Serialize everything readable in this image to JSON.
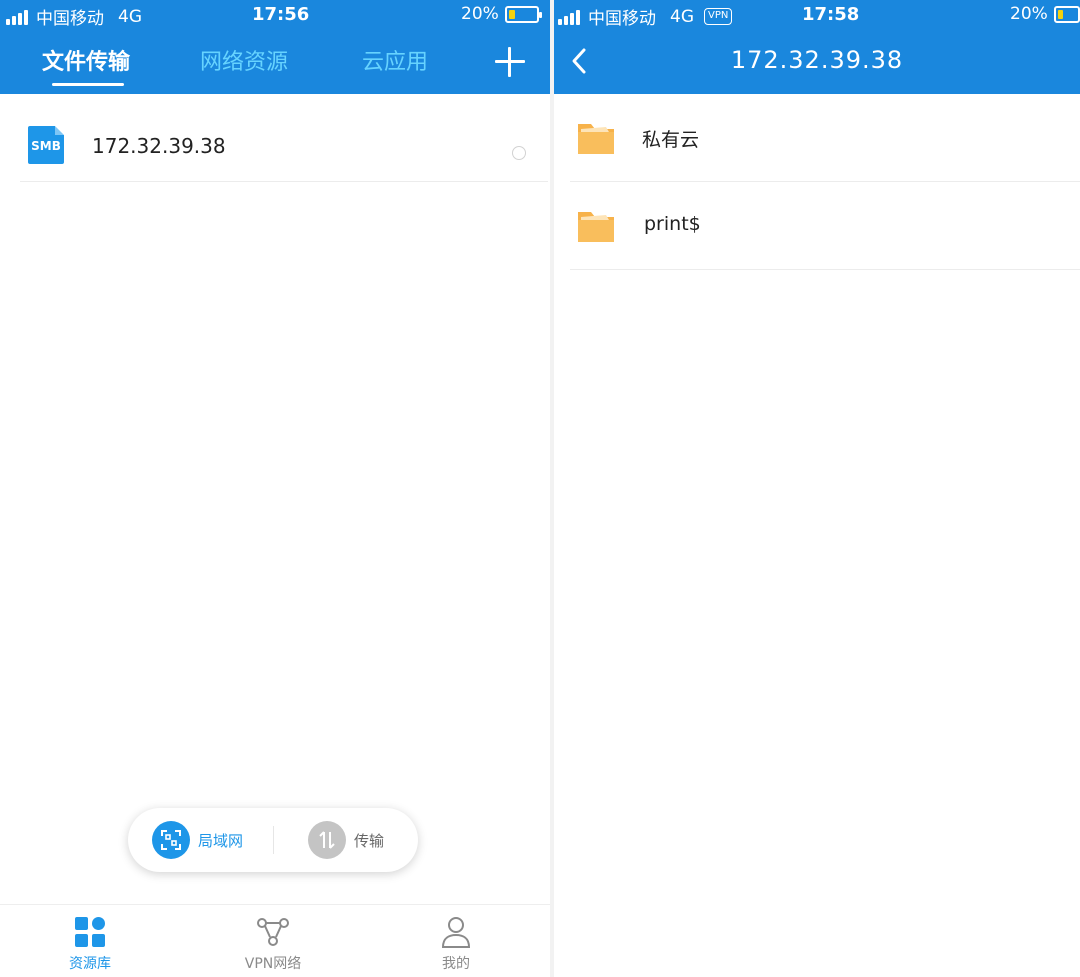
{
  "left": {
    "status": {
      "carrier": "中国移动",
      "network": "4G",
      "time": "17:56",
      "battery": "20%"
    },
    "tabs": [
      {
        "label": "文件传输",
        "active": true
      },
      {
        "label": "网络资源",
        "active": false
      },
      {
        "label": "云应用",
        "active": false
      }
    ],
    "rows": [
      {
        "icon_text": "SMB",
        "label": "172.32.39.38"
      }
    ],
    "pill": {
      "lan_label": "局域网",
      "transfer_label": "传输"
    },
    "bottom_nav": [
      {
        "label": "资源库",
        "active": true,
        "icon": "grid-icon"
      },
      {
        "label": "VPN网络",
        "active": false,
        "icon": "vpn-network-icon"
      },
      {
        "label": "我的",
        "active": false,
        "icon": "user-icon"
      }
    ]
  },
  "right": {
    "status": {
      "carrier": "中国移动",
      "network": "4G",
      "vpn_badge": "VPN",
      "time": "17:58",
      "battery": "20%"
    },
    "title": "172.32.39.38",
    "folders": [
      {
        "label": "私有云",
        "icon": "folder-icon"
      },
      {
        "label": "print$",
        "icon": "folder-icon"
      }
    ]
  },
  "colors": {
    "header_blue": "#1a87dd",
    "inactive_tab": "#66d3ff",
    "accent_blue": "#1e96e8",
    "folder": "#f7b24a",
    "nav_inactive": "#8a8a8a",
    "battery_level": "#f5d20e"
  }
}
